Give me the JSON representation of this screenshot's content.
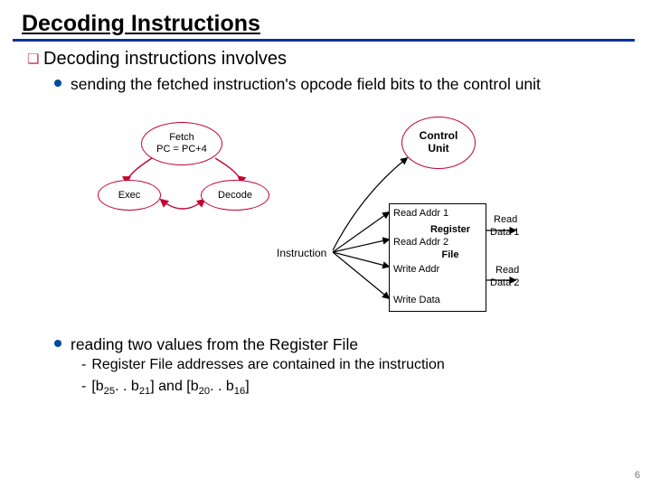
{
  "title": "Decoding Instructions",
  "bullet_q_glyph": "❏",
  "main_line": "Decoding instructions involves",
  "sub1": "sending the fetched instruction's opcode field bits to the control unit",
  "sub2": "reading two values from the Register File",
  "subsub1": "Register File addresses are contained in the instruction",
  "subsub2_prefix": "[b",
  "subsub2_25": "25",
  "subsub2_mid1": ". . b",
  "subsub2_21": "21",
  "subsub2_join": "] and [b",
  "subsub2_20": "20",
  "subsub2_mid2": ". . b",
  "subsub2_16": "16",
  "subsub2_suffix": "]",
  "diagram": {
    "fetch_line1": "Fetch",
    "fetch_line2": "PC = PC+4",
    "exec": "Exec",
    "decode": "Decode",
    "control_line1": "Control",
    "control_line2": "Unit",
    "instruction": "Instruction",
    "rf": {
      "read_addr1": "Read Addr 1",
      "read_addr2": "Read Addr 2",
      "write_addr": "Write Addr",
      "write_data": "Write Data",
      "register": "Register",
      "file": "File",
      "read_data1a": "Read",
      "read_data1b": "Data 1",
      "read_data2a": "Read",
      "read_data2b": "Data 2"
    }
  },
  "page_number": "6"
}
